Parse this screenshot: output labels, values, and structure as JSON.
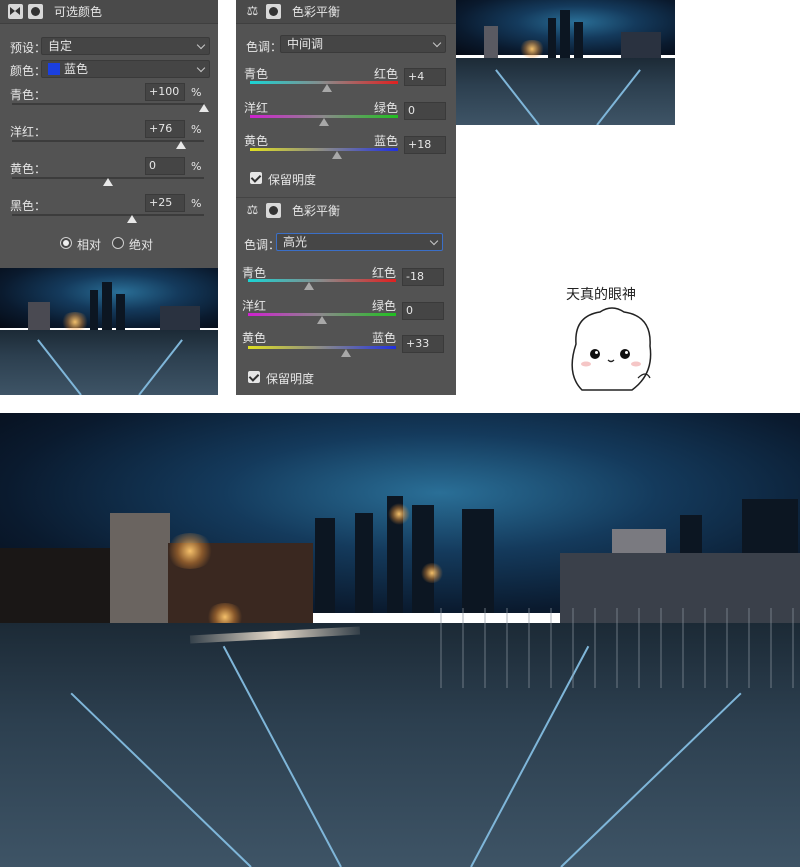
{
  "selective_color": {
    "title": "可选颜色",
    "preset_label": "预设：",
    "preset_value": "自定",
    "color_label": "颜色：",
    "color_value": "蓝色",
    "color_swatch": "#1a3fe0",
    "sliders": [
      {
        "label": "青色：",
        "value": "+100",
        "unit": "%",
        "level": 1.0
      },
      {
        "label": "洋红：",
        "value": "+76",
        "unit": "%",
        "level": 0.88
      },
      {
        "label": "黄色：",
        "value": "0",
        "unit": "%",
        "level": 0.5
      },
      {
        "label": "黑色：",
        "value": "+25",
        "unit": "%",
        "level": 0.625
      }
    ],
    "mode_relative": "相对",
    "mode_absolute": "绝对",
    "mode_selected": "relative"
  },
  "color_balance_mid": {
    "title": "色彩平衡",
    "tone_label": "色调：",
    "tone_value": "中间调",
    "sliders": [
      {
        "left": "青色",
        "right": "红色",
        "value": "+4",
        "level": 0.52
      },
      {
        "left": "洋红",
        "right": "绿色",
        "value": "0",
        "level": 0.5
      },
      {
        "left": "黄色",
        "right": "蓝色",
        "value": "+18",
        "level": 0.59
      }
    ],
    "preserve_label": "保留明度",
    "preserve_checked": true
  },
  "color_balance_high": {
    "title": "色彩平衡",
    "tone_label": "色调：",
    "tone_value": "高光",
    "sliders": [
      {
        "left": "青色",
        "right": "红色",
        "value": "-18",
        "level": 0.41
      },
      {
        "left": "洋红",
        "right": "绿色",
        "value": "0",
        "level": 0.5
      },
      {
        "left": "黄色",
        "right": "蓝色",
        "value": "+33",
        "level": 0.665
      }
    ],
    "preserve_label": "保留明度",
    "preserve_checked": true
  },
  "sticker": {
    "caption": "天真的眼神"
  }
}
